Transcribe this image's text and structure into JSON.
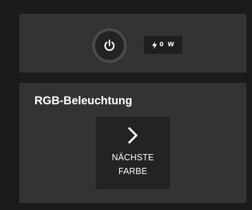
{
  "power_panel": {
    "power_button_icon": "power-icon",
    "watt_icon": "lightning-bolt-icon",
    "watt_value": "0 W"
  },
  "rgb_panel": {
    "title": "RGB-Beleuchtung",
    "next_color_button": {
      "icon": "chevron-right-icon",
      "label_line1": "NÄCHSTE",
      "label_line2": "FARBE"
    }
  },
  "colors": {
    "background": "#1b1b1b",
    "card": "#333333",
    "button": "#232323",
    "text": "#ffffff"
  }
}
